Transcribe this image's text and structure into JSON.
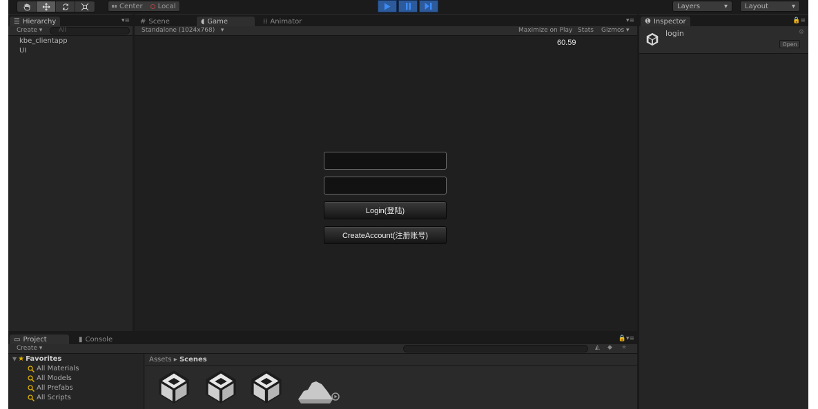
{
  "toolbar": {
    "pivot_label": "Center",
    "rotation_label": "Local",
    "layers_label": "Layers",
    "layout_label": "Layout"
  },
  "hierarchy": {
    "tab_label": "Hierarchy",
    "create_label": "Create",
    "search_placeholder": "All",
    "items": [
      "kbe_clientapp",
      "UI"
    ]
  },
  "center_tabs": {
    "scene": "Scene",
    "game": "Game",
    "animator": "Animator"
  },
  "game": {
    "resolution": "Standalone (1024x768)",
    "maximize_label": "Maximize on Play",
    "stats_label": "Stats",
    "gizmos_label": "Gizmos",
    "fps": "60.59",
    "username_value": "",
    "password_value": "",
    "login_button": "Login(登陆)",
    "create_account_button": "CreateAccount(注册账号)"
  },
  "inspector": {
    "tab_label": "Inspector",
    "object_name": "login",
    "open_label": "Open"
  },
  "project": {
    "tab_label": "Project",
    "console_label": "Console",
    "create_label": "Create",
    "favorites_label": "Favorites",
    "favorites": [
      "All Materials",
      "All Models",
      "All Prefabs",
      "All Scripts"
    ],
    "breadcrumb_root": "Assets",
    "breadcrumb_current": "Scenes"
  },
  "colors": {
    "play_active": "#2d5a9a",
    "panel_bg": "#252525",
    "favorites_icon": "#e0b000"
  }
}
